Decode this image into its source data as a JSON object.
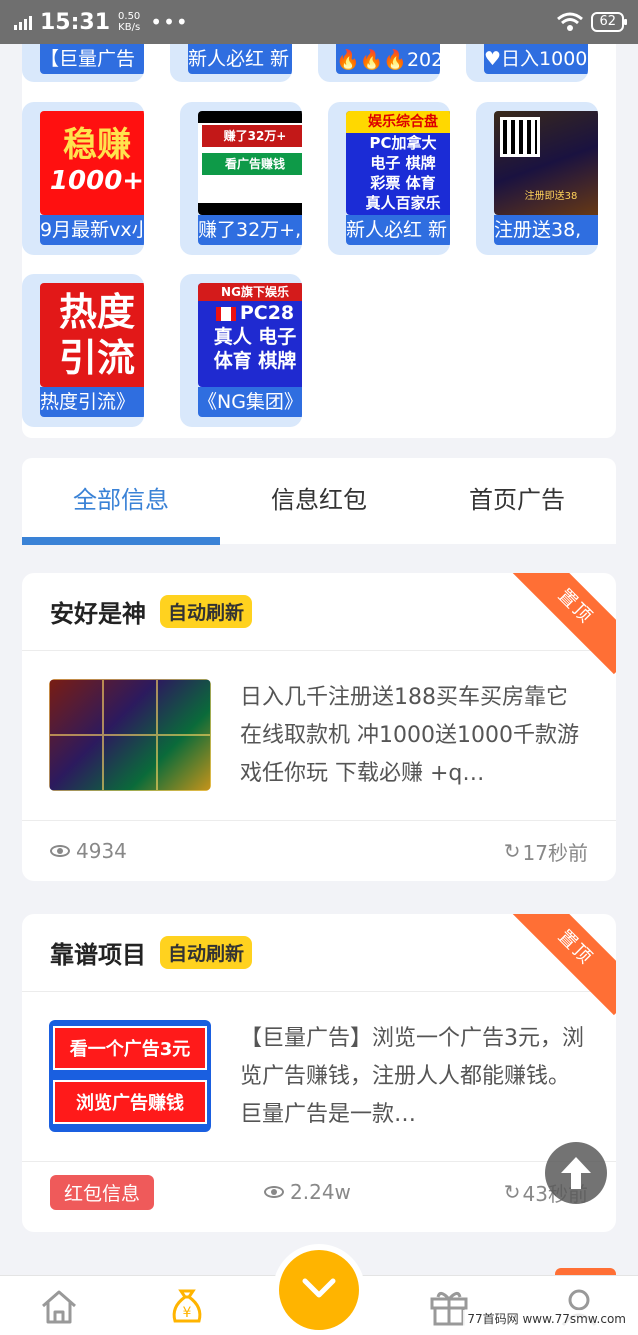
{
  "status_bar": {
    "time": "15:31",
    "net_speed": "0.50",
    "net_unit": "KB/s",
    "dots": "•••",
    "battery": "62"
  },
  "grid": {
    "top_row": [
      "【巨量广告",
      "新人必红 新",
      "🔥🔥🔥202",
      "♥日入1000"
    ],
    "row2": [
      {
        "caption": "9月最新vx⼩",
        "thumb_l1": "稳赚",
        "thumb_l2": "1000+"
      },
      {
        "caption": "赚了32万+,",
        "thumb_l1": "赚了32万+",
        "thumb_l2": "看广告赚钱"
      },
      {
        "caption": "新人必红 新",
        "thumb_head": "娱乐综合盘",
        "thumb_lines": [
          "PC加拿大",
          "电子  棋牌",
          "彩票  体育",
          "真人百家乐"
        ]
      },
      {
        "caption": "注册送38,",
        "thumb_text": "注册即送38"
      }
    ],
    "row3": [
      {
        "caption": "热度引流》",
        "thumb_lines": [
          "热度",
          "引流"
        ]
      },
      {
        "caption": "《NG集团》",
        "thumb_head": "NG旗下娱乐",
        "thumb_lines": [
          "PC28",
          "真人 电子",
          "体育 棋牌"
        ]
      }
    ]
  },
  "tabs": [
    "全部信息",
    "信息红包",
    "首页广告"
  ],
  "posts": [
    {
      "title": "安好是神",
      "badge": "自动刷新",
      "ribbon": "置顶",
      "text": "日入几千注册送188买车买房靠它 在线取款机 冲1000送1000千款游戏任你玩 下载必赚 +q…",
      "views": "4934",
      "time": "17秒前"
    },
    {
      "title": "靠谱项目",
      "badge": "自动刷新",
      "ribbon": "置顶",
      "text": "【巨量广告】浏览一个广告3元，浏览广告赚钱，注册人人都能赚钱。巨量广告是一款…",
      "img_l1": "看一个广告3元",
      "img_l2": "浏览广告赚钱",
      "tag": "红包信息",
      "views": "2.24w",
      "time": "43秒前"
    }
  ],
  "watermark": "77首码网 www.77smw.com",
  "colors": {
    "accent": "#3a82d6",
    "badge": "#ffd21f",
    "ribbon": "#ff6f35",
    "tile_bg": "#d9e8fb",
    "nav_active": "#ffb400"
  }
}
